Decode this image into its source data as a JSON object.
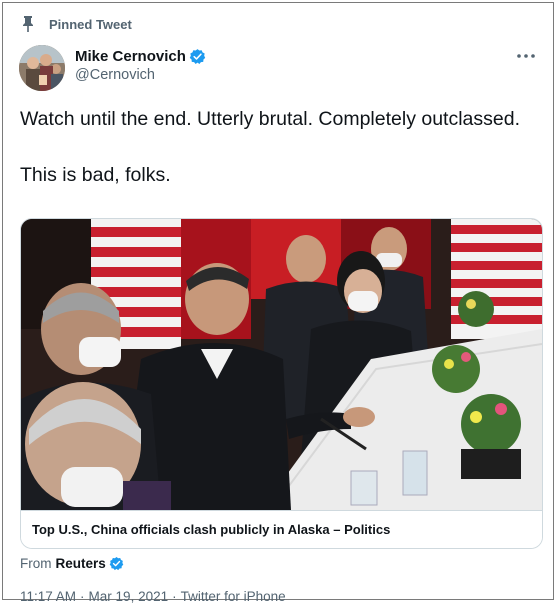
{
  "pinned": {
    "label": "Pinned Tweet",
    "icon": "pin-icon"
  },
  "author": {
    "name": "Mike Cernovich",
    "handle": "@Cernovich",
    "verified": true,
    "verified_color": "#1d9bf0"
  },
  "tweet": {
    "text": "Watch until the end. Utterly brutal. Completely outclassed.\n\nThis is bad, folks."
  },
  "card": {
    "title": "Top U.S., China officials clash publicly in Alaska – Politics",
    "image_description": "Press conference photo: officials seated at a long table with flags and flowers"
  },
  "source": {
    "prefix": "From",
    "name": "Reuters",
    "verified": true
  },
  "meta": {
    "time": "11:17 AM",
    "date": "Mar 19, 2021",
    "client": "Twitter for iPhone",
    "separator": "·"
  },
  "colors": {
    "text_primary": "#0f1419",
    "text_secondary": "#536471",
    "border": "#cfd9de",
    "verified_blue": "#1d9bf0"
  }
}
